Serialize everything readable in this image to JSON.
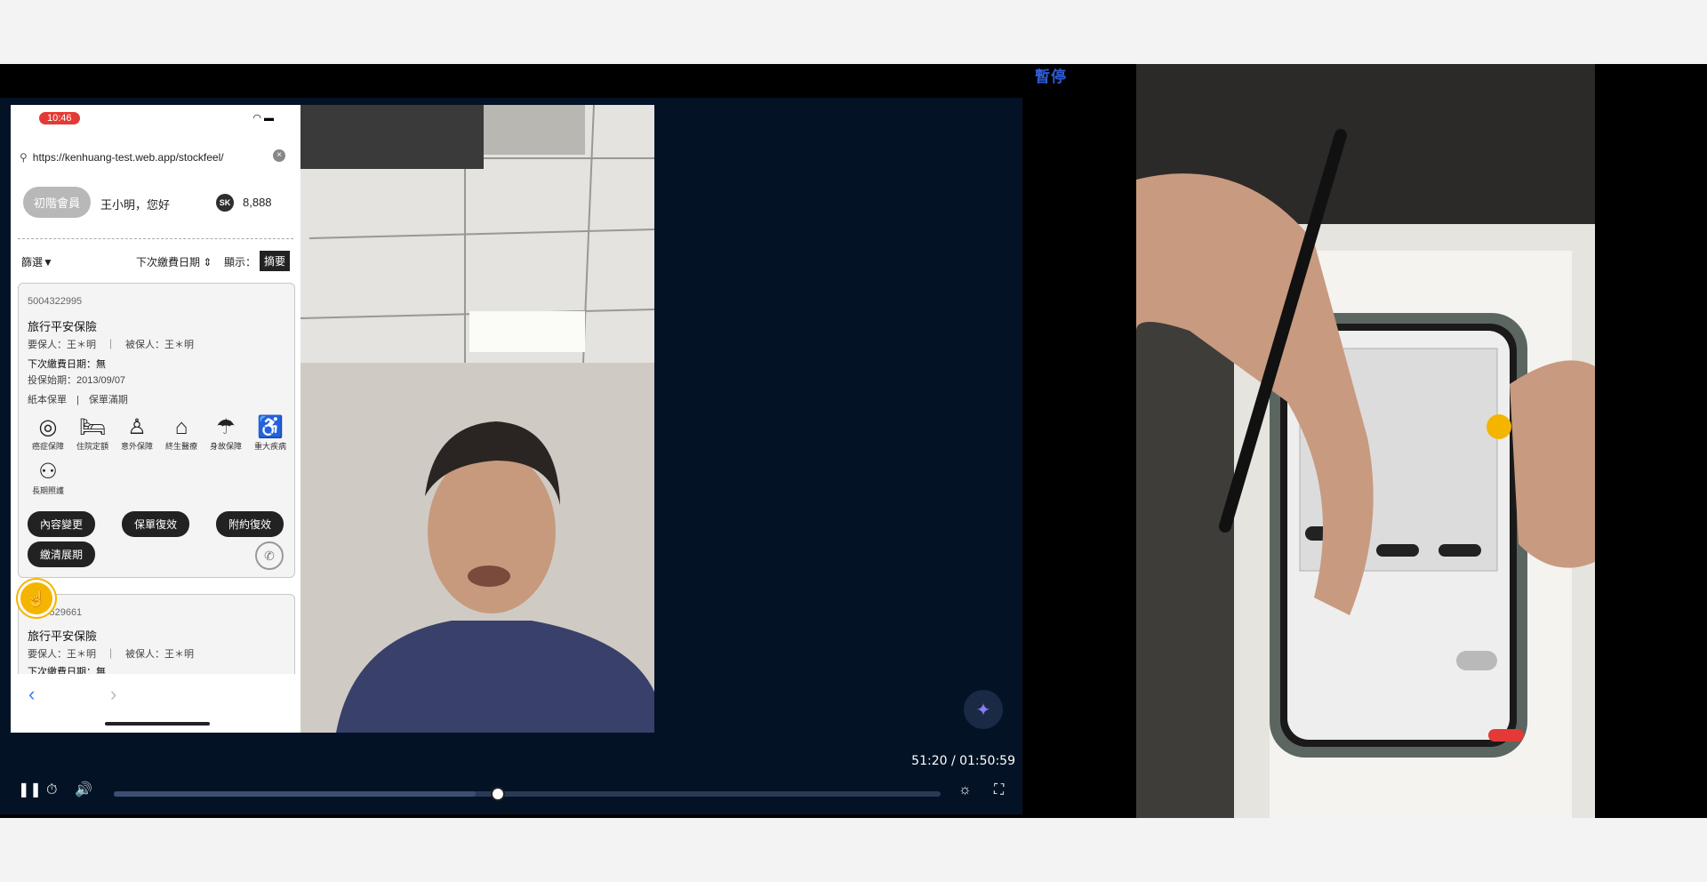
{
  "status": {
    "pause_label": "暫停"
  },
  "phone": {
    "time": "10:46",
    "url": "https://kenhuang-test.web.app/stockfeel/",
    "member_badge": "初階會員",
    "greeting": "王小明，您好",
    "sk_icon": "SK",
    "sk_amount": "8,888",
    "filter_label": "篩選",
    "sort_label": "下次繳費日期",
    "display_label": "顯示：",
    "display_value": "摘要"
  },
  "policies": [
    {
      "number": "5004322995",
      "title": "旅行平安保險",
      "insurer": "要保人：王＊明",
      "insured": "被保人：王＊明",
      "next_due": "下次繳費日期：無",
      "start_date": "投保始期：2013/09/07",
      "paper": "紙本保單",
      "expired": "保單滿期",
      "coverages": [
        "癌症保障",
        "住院定額",
        "意外保障",
        "終生醫療",
        "身故保障",
        "重大疾病",
        "長期照護"
      ],
      "actions": [
        "內容變更",
        "保單復效",
        "附約復效",
        "繳清展期"
      ]
    },
    {
      "number": "5013529661",
      "title": "旅行平安保險",
      "insurer": "要保人：王＊明",
      "insured": "被保人：王＊明",
      "next_due": "下次繳費日期：無"
    }
  ],
  "player": {
    "time": "51:20 / 01:50:59",
    "progress": 0.462,
    "buffered": 0.438
  },
  "icons": [
    "pause-icon",
    "timer-icon",
    "volume-icon",
    "brightness-icon",
    "fullscreen-icon",
    "sparkle-icon",
    "hand-icon",
    "phone-icon",
    "search-icon",
    "wifi-icon",
    "battery-icon",
    "filter-icon"
  ]
}
